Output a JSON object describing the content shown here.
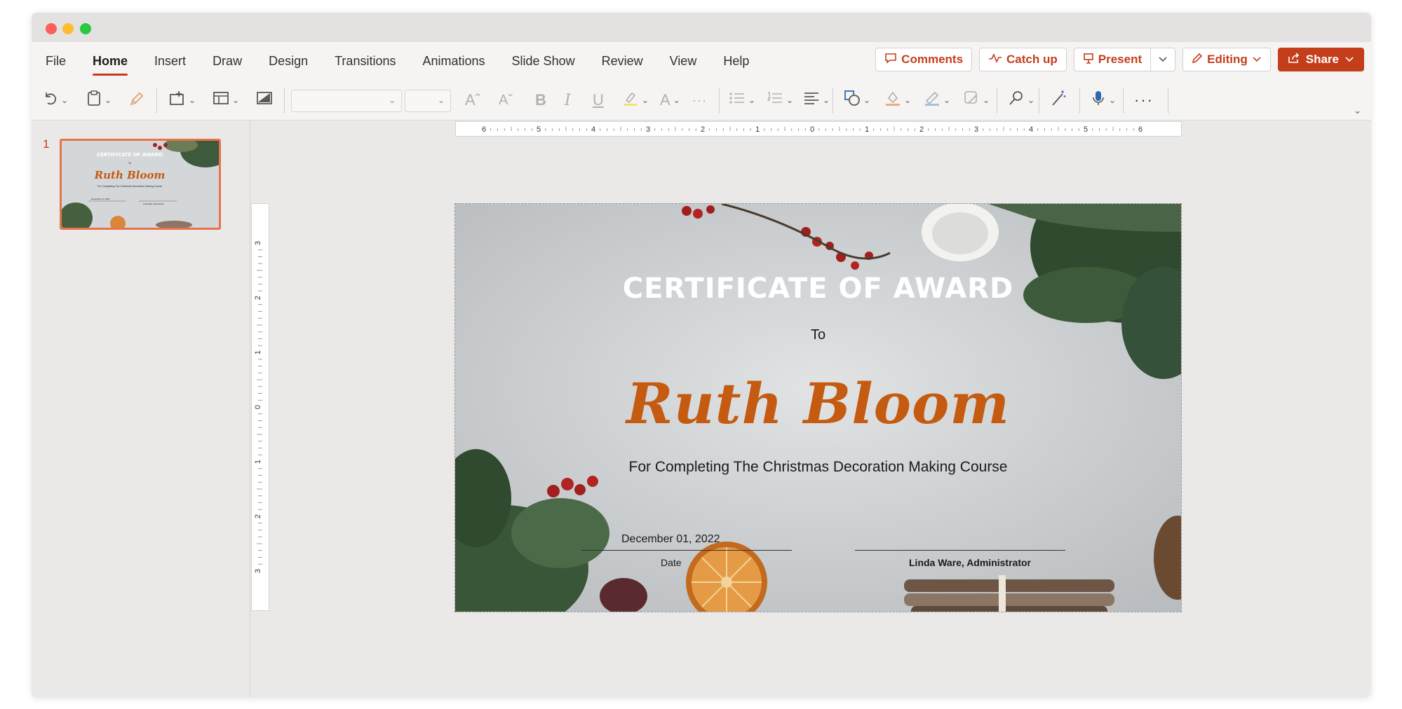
{
  "app": {
    "accent": "#c43e1c"
  },
  "menu": {
    "tabs": [
      "File",
      "Home",
      "Insert",
      "Draw",
      "Design",
      "Transitions",
      "Animations",
      "Slide Show",
      "Review",
      "View",
      "Help"
    ],
    "active_tab": "Home"
  },
  "actions": {
    "comments": "Comments",
    "catchup": "Catch up",
    "present": "Present",
    "editing": "Editing",
    "share": "Share"
  },
  "ribbon": {
    "icons": [
      "undo-icon",
      "paste-icon",
      "format-painter-icon",
      "new-slide-icon",
      "layout-icon",
      "reset-icon",
      "font-name-dropdown",
      "font-size-dropdown",
      "grow-font-icon",
      "shrink-font-icon",
      "bold-icon",
      "italic-icon",
      "underline-icon",
      "highlight-icon",
      "font-color-icon",
      "more-font-icon",
      "bullets-icon",
      "numbering-icon",
      "align-icon",
      "shapes-icon",
      "shape-fill-icon",
      "shape-outline-icon",
      "shape-effects-icon",
      "find-icon",
      "designer-icon",
      "dictate-icon",
      "more-icon"
    ]
  },
  "thumbnails": {
    "slide_number": "1",
    "mini": {
      "title": "CERTIFICATE OF AWARD",
      "to": "To",
      "name": "Ruth Bloom",
      "subtitle": "For Completing The Christmas Decoration Making Course",
      "date": "December 01, 2022",
      "signer": "Linda Ware, Administrator"
    }
  },
  "ruler": {
    "horizontal": [
      "6",
      "5",
      "4",
      "3",
      "2",
      "1",
      "0",
      "1",
      "2",
      "3",
      "4",
      "5",
      "6"
    ],
    "vertical": [
      "3",
      "2",
      "1",
      "0",
      "1",
      "2",
      "3"
    ]
  },
  "slide": {
    "title": "CERTIFICATE OF AWARD",
    "to": "To",
    "name": "Ruth Bloom",
    "subtitle": "For Completing The Christmas Decoration Making Course",
    "date": "December 01, 2022",
    "date_label": "Date",
    "signer_label": "Linda Ware, Administrator",
    "colors": {
      "name": "#c55a11",
      "title": "#ffffff",
      "background": "#d4d7d9"
    }
  }
}
